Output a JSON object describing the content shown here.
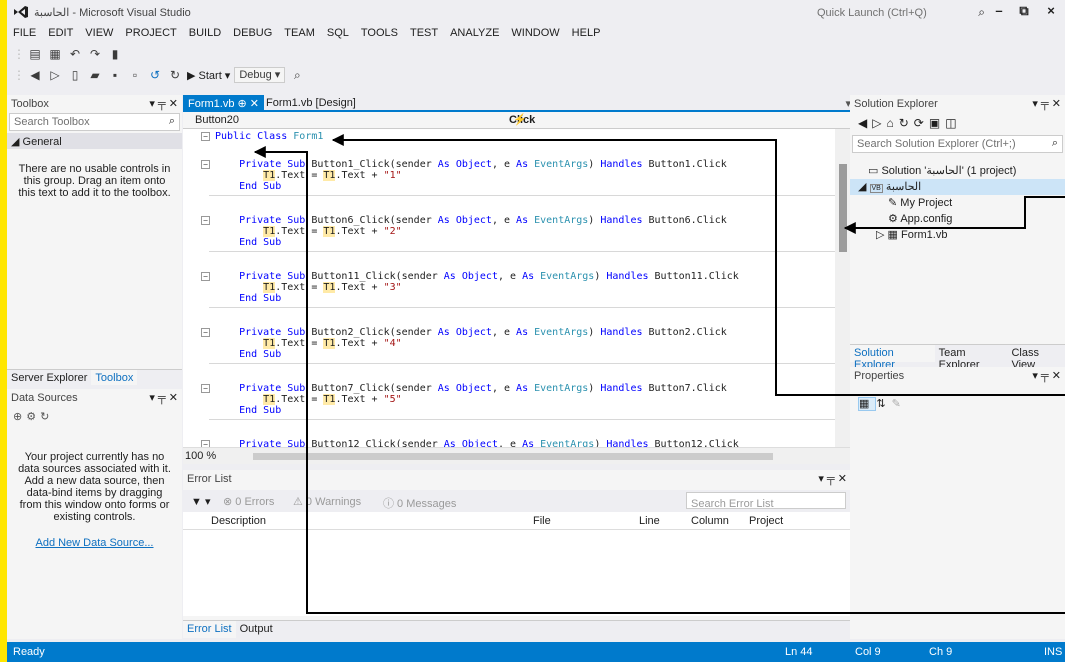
{
  "window": {
    "title": "الحاسبة - Microsoft Visual Studio",
    "quick_launch_placeholder": "Quick Launch (Ctrl+Q)"
  },
  "menu": [
    "FILE",
    "EDIT",
    "VIEW",
    "PROJECT",
    "BUILD",
    "DEBUG",
    "TEAM",
    "SQL",
    "TOOLS",
    "TEST",
    "ANALYZE",
    "WINDOW",
    "HELP"
  ],
  "toolbar": {
    "start_label": "▶ Start ▾",
    "config": "Debug ▾"
  },
  "toolbox": {
    "title": "Toolbox",
    "search_placeholder": "Search Toolbox",
    "group": "◢ General",
    "empty_msg": "There are no usable controls in this group. Drag an item onto this text to add it to the toolbox.",
    "tabs": [
      "Server Explorer",
      "Toolbox"
    ]
  },
  "data_sources": {
    "title": "Data Sources",
    "empty_msg": "Your project currently has no data sources associated with it. Add a new data source, then data-bind items by dragging from this window onto forms or existing controls.",
    "link": "Add New Data Source..."
  },
  "editor": {
    "tabs": [
      "Form1.vb",
      "Form1.vb [Design]"
    ],
    "object_dropdown": "Button20",
    "event_dropdown": "Click",
    "zoom": "100 %",
    "lines": [
      {
        "kind": "cls",
        "text": "Public Class Form1"
      },
      {
        "kind": "sub",
        "name": "Button1_Click",
        "handles": "Button1.Click",
        "val": "\"1\""
      },
      {
        "kind": "sub",
        "name": "Button6_Click",
        "handles": "Button6.Click",
        "val": "\"2\""
      },
      {
        "kind": "sub",
        "name": "Button11_Click",
        "handles": "Button11.Click",
        "val": "\"3\""
      },
      {
        "kind": "sub",
        "name": "Button2_Click",
        "handles": "Button2.Click",
        "val": "\"4\""
      },
      {
        "kind": "sub",
        "name": "Button7_Click",
        "handles": "Button7.Click",
        "val": "\"5\""
      },
      {
        "kind": "sub",
        "name": "Button12_Click",
        "handles": "Button12.Click",
        "val": ""
      }
    ]
  },
  "error_list": {
    "title": "Error List",
    "errors": "⊗ 0 Errors",
    "warnings": "⚠ 0 Warnings",
    "messages": "ⓘ 0 Messages",
    "search_placeholder": "Search Error List",
    "columns": [
      "Description",
      "File",
      "Line",
      "Column",
      "Project"
    ],
    "tabs": [
      "Error List",
      "Output"
    ]
  },
  "solution_explorer": {
    "title": "Solution Explorer",
    "search_placeholder": "Search Solution Explorer (Ctrl+;)",
    "nodes": [
      "Solution 'الحاسبة' (1 project)",
      "الحاسبة",
      "My Project",
      "App.config",
      "Form1.vb"
    ],
    "tabs": [
      "Solution Explorer",
      "Team Explorer",
      "Class View"
    ]
  },
  "properties": {
    "title": "Properties"
  },
  "status": {
    "ready": "Ready",
    "ln": "Ln 44",
    "col": "Col 9",
    "ch": "Ch 9",
    "mode": "INS"
  },
  "colors": {
    "accent": "#007acc",
    "highlight": "#ffeaa7",
    "yellow_bar": "#ffe600"
  }
}
